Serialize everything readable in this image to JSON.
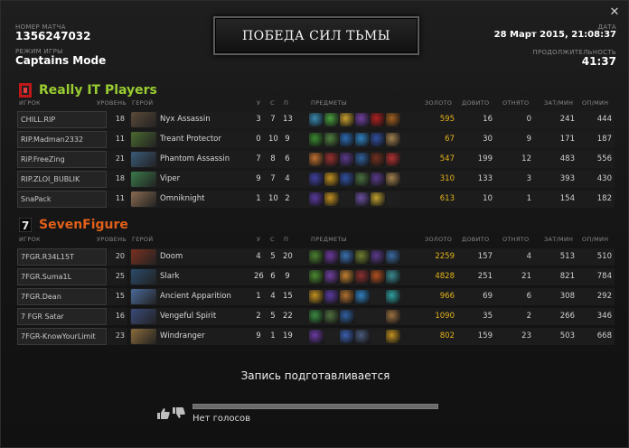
{
  "header": {
    "match_id_label": "НОМЕР МАТЧА",
    "match_id": "1356247032",
    "mode_label": "РЕЖИМ ИГРЫ",
    "mode": "Captains Mode",
    "result_title": "ПОБЕДА СИЛ ТЬМЫ",
    "date_label": "ДАТА",
    "date": "28 Март 2015, 21:08:37",
    "duration_label": "ПРОДОЛЖИТЕЛЬНОСТЬ",
    "duration": "41:37"
  },
  "columns": {
    "player": "ИГРОК",
    "level": "УРОВЕНЬ",
    "hero": "ГЕРОЙ",
    "k": "У",
    "d": "С",
    "a": "П",
    "items": "ПРЕДМЕТЫ",
    "gold": "ЗОЛОТО",
    "last_hits": "ДОВИТО",
    "denies": "ОТНЯТО",
    "gpm": "ЗАТ/МИН",
    "xpm": "ОП/МИН"
  },
  "teams": [
    {
      "name": "Really IT Players",
      "name_color": "#9acd32",
      "players": [
        {
          "player": "CHILL.RIP",
          "level": "18",
          "hero": "Nyx Assassin",
          "k": "3",
          "d": "7",
          "a": "13",
          "gold": "595",
          "lh": "16",
          "dn": "0",
          "gpm": "241",
          "xpm": "444",
          "portrait": "#5a4a38",
          "items": [
            "#3a8ab0",
            "#4aa040",
            "#c8a030",
            "#7040a0",
            "#b02020",
            "#a06020"
          ]
        },
        {
          "player": "RIP.Madman2332",
          "level": "11",
          "hero": "Treant Protector",
          "k": "0",
          "d": "10",
          "a": "9",
          "gold": "67",
          "lh": "30",
          "dn": "9",
          "gpm": "171",
          "xpm": "187",
          "portrait": "#4a6a30",
          "items": [
            "#3a8a30",
            "#508040",
            "#2a6ab0",
            "#3080c0",
            "#3050a0",
            "#a08050"
          ]
        },
        {
          "player": "RiP.FreeZing",
          "level": "21",
          "hero": "Phantom Assassin",
          "k": "7",
          "d": "8",
          "a": "6",
          "gold": "547",
          "lh": "199",
          "dn": "12",
          "gpm": "483",
          "xpm": "556",
          "portrait": "#3a5a7a",
          "items": [
            "#c07030",
            "#9a3030",
            "#5a3a8a",
            "#30609a",
            "#703020",
            "#b03030"
          ]
        },
        {
          "player": "RIP.ZLOI_BUBLIK",
          "level": "18",
          "hero": "Viper",
          "k": "9",
          "d": "7",
          "a": "4",
          "gold": "310",
          "lh": "133",
          "dn": "3",
          "gpm": "393",
          "xpm": "430",
          "portrait": "#3a7a4a",
          "items": [
            "#4040a0",
            "#c09020",
            "#3050a0",
            "#4a7040",
            "#5a3a8a",
            "#a08050"
          ]
        },
        {
          "player": "SnaPack",
          "level": "11",
          "hero": "Omniknight",
          "k": "1",
          "d": "10",
          "a": "2",
          "gold": "613",
          "lh": "10",
          "dn": "1",
          "gpm": "154",
          "xpm": "182",
          "portrait": "#8a6a50",
          "items": [
            "#5a3aa0",
            "#c09020",
            "#1e1e1e",
            "#6a50a0",
            "#c0a030",
            "#1e1e1e"
          ]
        }
      ]
    },
    {
      "name": "SevenFigure",
      "name_color": "#e0601a",
      "players": [
        {
          "player": "7FGR.R34L15T",
          "level": "20",
          "hero": "Doom",
          "k": "4",
          "d": "5",
          "a": "20",
          "gold": "2259",
          "lh": "157",
          "dn": "4",
          "gpm": "513",
          "xpm": "510",
          "portrait": "#7a3020",
          "items": [
            "#4a8030",
            "#6a3a9a",
            "#3a70b0",
            "#708030",
            "#5a3a8a",
            "#3a6aa0"
          ]
        },
        {
          "player": "7FGR.Suma1L",
          "level": "25",
          "hero": "Slark",
          "k": "26",
          "d": "6",
          "a": "9",
          "gold": "4828",
          "lh": "251",
          "dn": "21",
          "gpm": "821",
          "xpm": "784",
          "portrait": "#2a4a6a",
          "items": [
            "#4a8a30",
            "#7040a0",
            "#c08030",
            "#8a3030",
            "#b05020",
            "#3a8a90"
          ]
        },
        {
          "player": "7FGR.Dean",
          "level": "15",
          "hero": "Ancient Apparition",
          "k": "1",
          "d": "4",
          "a": "15",
          "gold": "966",
          "lh": "69",
          "dn": "6",
          "gpm": "308",
          "xpm": "292",
          "portrait": "#4a6a9a",
          "items": [
            "#c09020",
            "#5a3aa0",
            "#b07030",
            "#3080c0",
            "#1e1e1e",
            "#30a0a0"
          ]
        },
        {
          "player": "7 FGR Satar",
          "level": "16",
          "hero": "Vengeful Spirit",
          "k": "2",
          "d": "5",
          "a": "22",
          "gold": "1090",
          "lh": "35",
          "dn": "2",
          "gpm": "266",
          "xpm": "346",
          "portrait": "#3a4a7a",
          "items": [
            "#3a8a40",
            "#507040",
            "#3060a0",
            "#1e1e1e",
            "#1e1e1e",
            "#9a7040"
          ]
        },
        {
          "player": "7FGR-KnowYourLimit",
          "level": "23",
          "hero": "Windranger",
          "k": "9",
          "d": "1",
          "a": "19",
          "gold": "802",
          "lh": "159",
          "dn": "23",
          "gpm": "503",
          "xpm": "668",
          "portrait": "#8a6a3a",
          "items": [
            "#6a3aa0",
            "#1e1e1e",
            "#3a60b0",
            "#4a5a7a",
            "#1e1e1e",
            "#c09020"
          ]
        }
      ]
    }
  ],
  "footer": {
    "status": "Запись подготавливается",
    "no_votes": "Нет голосов",
    "thumb_up_icon": "thumbs-up-icon",
    "thumb_down_icon": "thumbs-down-icon"
  },
  "close_label": "✕"
}
